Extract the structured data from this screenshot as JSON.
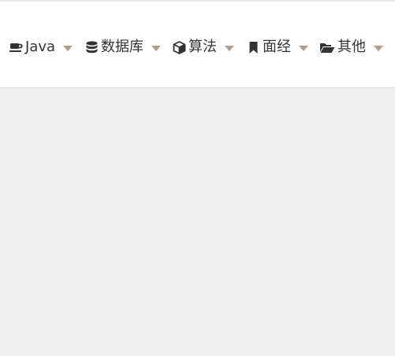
{
  "nav": {
    "items": [
      {
        "label": "Java",
        "icon": "coffee-icon"
      },
      {
        "label": "数据库",
        "icon": "database-icon"
      },
      {
        "label": "算法",
        "icon": "cube-icon"
      },
      {
        "label": "面经",
        "icon": "bookmark-icon"
      },
      {
        "label": "其他",
        "icon": "folder-open-icon"
      }
    ]
  },
  "colors": {
    "caret": "#b69c87",
    "text": "#333333",
    "navbar_bg": "#ffffff",
    "page_bg": "#efefef"
  }
}
